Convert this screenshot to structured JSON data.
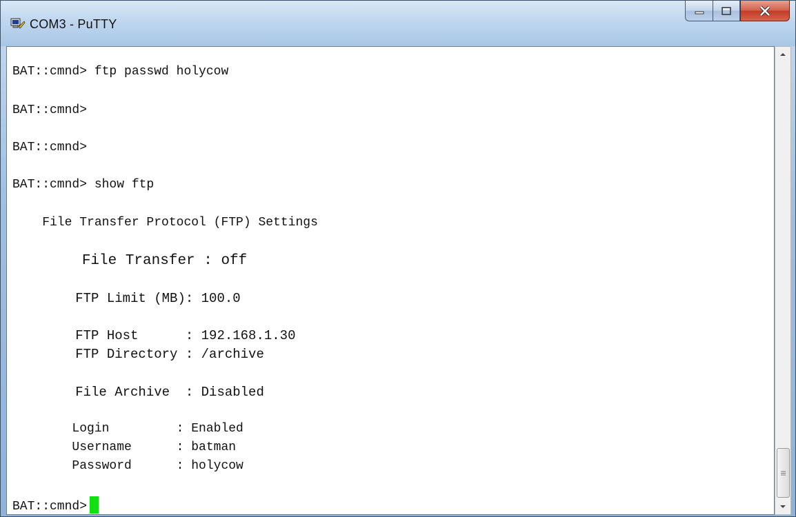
{
  "window": {
    "title": "COM3 - PuTTY",
    "icon": "putty-icon",
    "controls": [
      "minimize-icon",
      "maximize-icon",
      "close-icon"
    ]
  },
  "terminal": {
    "lines": [
      "BAT::cmnd> ftp passwd holycow",
      "BAT::cmnd>",
      "BAT::cmnd>",
      "BAT::cmnd> show ftp",
      "    File Transfer Protocol (FTP) Settings",
      "        File Transfer : off",
      "        FTP Limit (MB): 100.0",
      "        FTP Host      : 192.168.1.30",
      "        FTP Directory : /archive",
      "        File Archive  : Disabled",
      "        Login         : Enabled",
      "        Username      : batman",
      "        Password      : holycow",
      "BAT::cmnd>"
    ],
    "cursor_color": "#10e010",
    "text_color": "#111111",
    "background": "#ffffff"
  },
  "colors": {
    "titlebar": "#bfd6ee",
    "close_button": "#c13b25"
  }
}
